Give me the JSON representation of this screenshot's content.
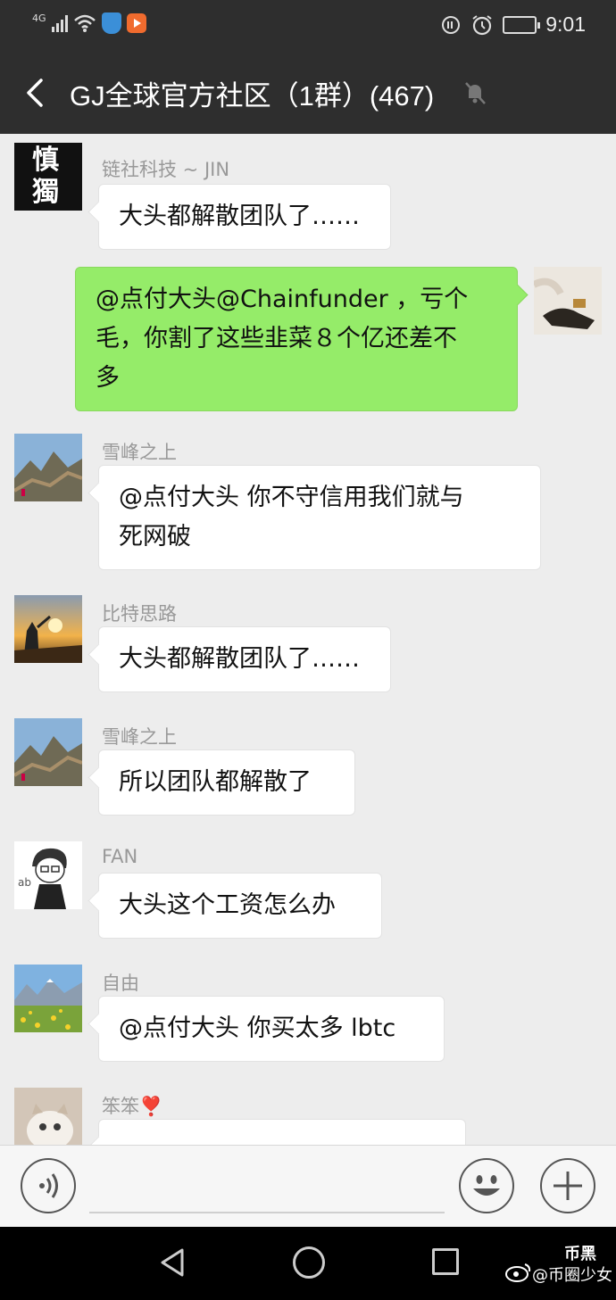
{
  "status_bar": {
    "network": "4G",
    "time": "9:01"
  },
  "header": {
    "title": "GJ全球官方社区（1群）(467)"
  },
  "messages": [
    {
      "sender": "链社科技 ~ JIN",
      "text": "大头都解散团队了……",
      "avatar_chars": "慎獨"
    },
    {
      "sender": "",
      "text_lines": [
        "@点付大头@Chainfunder ，亏个",
        "毛，你割了这些韭菜８个亿还差不",
        "多"
      ]
    },
    {
      "sender": "雪峰之上",
      "text_lines": [
        "@点付大头  你不守信用我们就与",
        "死网破"
      ]
    },
    {
      "sender": "比特思路",
      "text": "大头都解散团队了……"
    },
    {
      "sender": "雪峰之上",
      "text": "所以团队都解散了"
    },
    {
      "sender": "FAN",
      "text": "大头这个工资怎么办"
    },
    {
      "sender": "自由",
      "text": "@点付大头  你买太多 lbtc"
    },
    {
      "sender": "笨笨❣️",
      "text": "…"
    }
  ],
  "watermark": {
    "top": "币黑",
    "bottom": "@币圈少女"
  },
  "colors": {
    "bar_bg": "#2e2e2e",
    "chat_bg": "#ededed",
    "my_bubble": "#95ec69",
    "other_bubble": "#ffffff"
  }
}
